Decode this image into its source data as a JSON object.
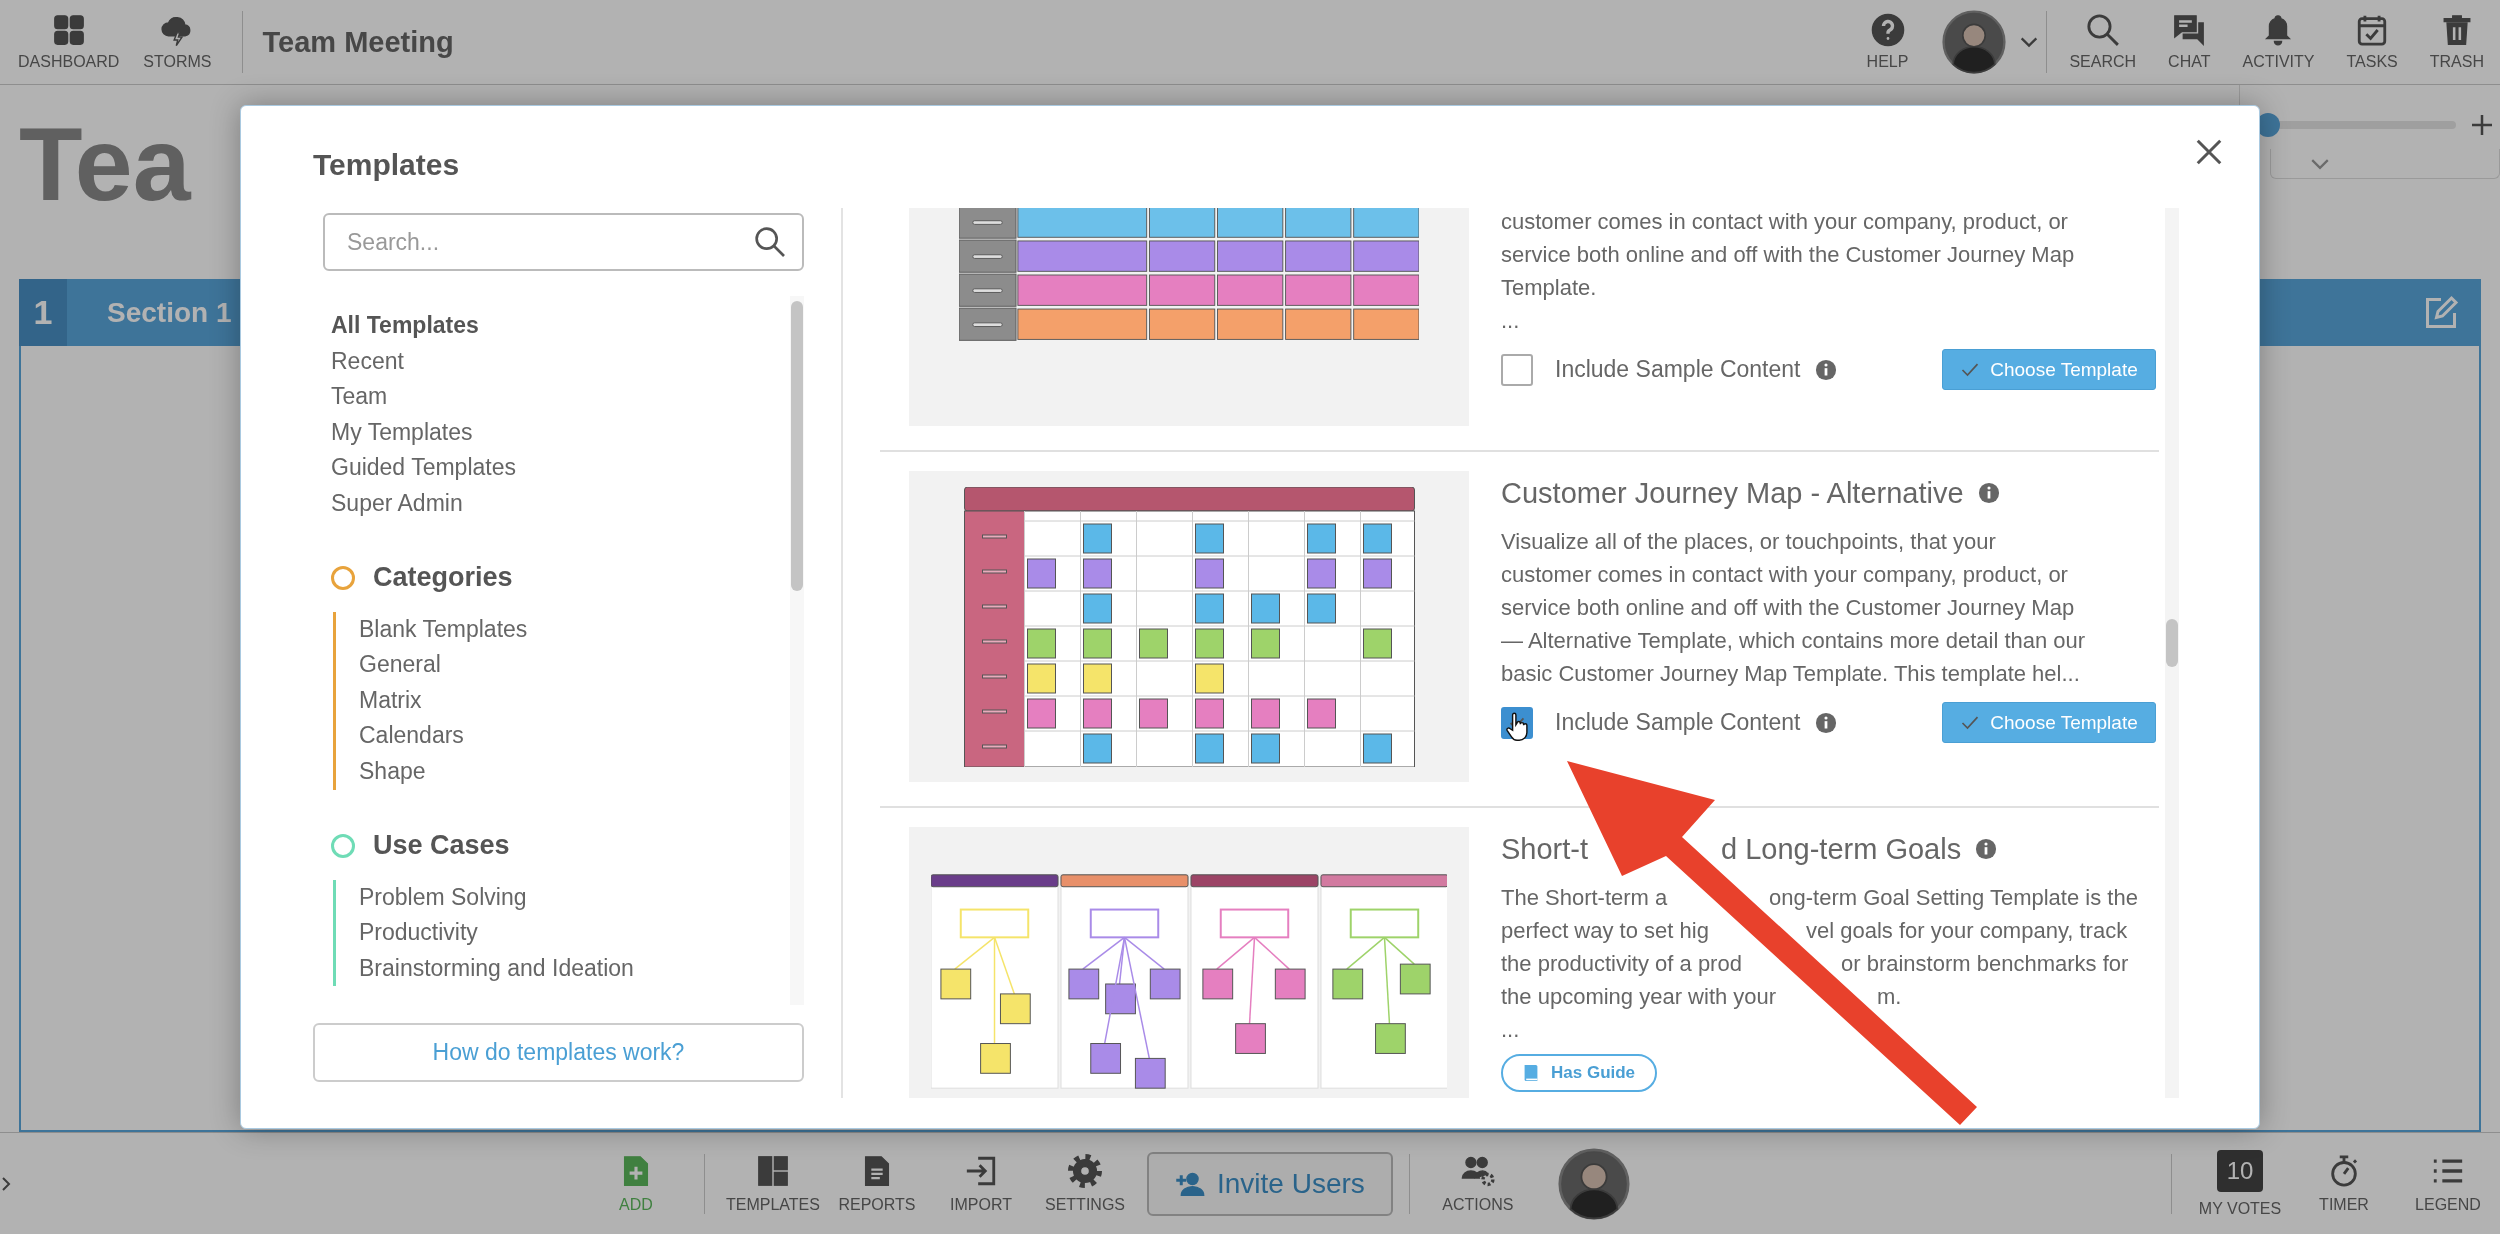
{
  "top_bar": {
    "nav": [
      {
        "label": "DASHBOARD"
      },
      {
        "label": "STORMS"
      }
    ],
    "board_title": "Team Meeting",
    "tools": [
      {
        "label": "HELP"
      },
      {
        "label": "SEARCH"
      },
      {
        "label": "CHAT"
      },
      {
        "label": "ACTIVITY"
      },
      {
        "label": "TASKS"
      },
      {
        "label": "TRASH"
      }
    ]
  },
  "page_title": "Tea",
  "zoom_slider": {
    "level": 0
  },
  "section": {
    "number": "1",
    "title": "Section 1"
  },
  "modal": {
    "title": "Templates",
    "search": {
      "placeholder": "Search..."
    },
    "nav": [
      {
        "label": "All Templates",
        "selected": true
      },
      {
        "label": "Recent",
        "selected": false
      },
      {
        "label": "Team",
        "selected": false
      },
      {
        "label": "My Templates",
        "selected": false
      },
      {
        "label": "Guided Templates",
        "selected": false
      },
      {
        "label": "Super Admin",
        "selected": false
      }
    ],
    "groups": [
      {
        "title": "Categories",
        "color": "#e8a33c",
        "items": [
          "Blank Templates",
          "General",
          "Matrix",
          "Calendars",
          "Shape"
        ]
      },
      {
        "title": "Use Cases",
        "color": "#6fdcb6",
        "items": [
          "Problem Solving",
          "Productivity",
          "Brainstorming and Ideation"
        ]
      }
    ],
    "help_link": "How do templates work?",
    "templates": [
      {
        "lines": [
          "customer comes in contact with your company, product, or",
          "service both online and off with the Customer Journey Map",
          "Template."
        ],
        "more": "...",
        "include_sample": {
          "label": "Include Sample Content",
          "checked": false
        },
        "choose_button": "Choose Template"
      },
      {
        "title": "Customer Journey Map - Alternative",
        "lines": [
          "Visualize all of the places, or touchpoints, that your",
          "customer comes in contact with your company, product, or",
          "service both online and off with the Customer Journey Map",
          "— Alternative Template, which contains more detail than our",
          "basic Customer Journey Map Template. This template hel..."
        ],
        "include_sample": {
          "label": "Include Sample Content",
          "checked": true
        },
        "choose_button": "Choose Template"
      },
      {
        "title": [
          "Short-t",
          "d Long-term Goals"
        ],
        "lines": [
          [
            "The Short-term a",
            "ong-term Goal Setting Template is the"
          ],
          [
            "perfect way to set hig",
            "vel goals for your company, track"
          ],
          [
            "the productivity of a prod",
            "or brainstorm benchmarks for"
          ],
          [
            "the upcoming year with your",
            "m."
          ]
        ],
        "more": "...",
        "guide_badge": "Has Guide"
      }
    ]
  },
  "bottom_bar": {
    "tools": [
      {
        "label": "ADD",
        "kind": "primary"
      },
      {
        "label": "TEMPLATES",
        "kind": "normal"
      },
      {
        "label": "REPORTS",
        "kind": "normal"
      },
      {
        "label": "IMPORT",
        "kind": "normal"
      },
      {
        "label": "SETTINGS",
        "kind": "normal"
      }
    ],
    "invite_button": "Invite Users",
    "actions_label": "ACTIONS",
    "right_tools": [
      {
        "label": "MY VOTES",
        "badge": "10"
      },
      {
        "label": "TIMER"
      },
      {
        "label": "LEGEND"
      }
    ]
  }
}
